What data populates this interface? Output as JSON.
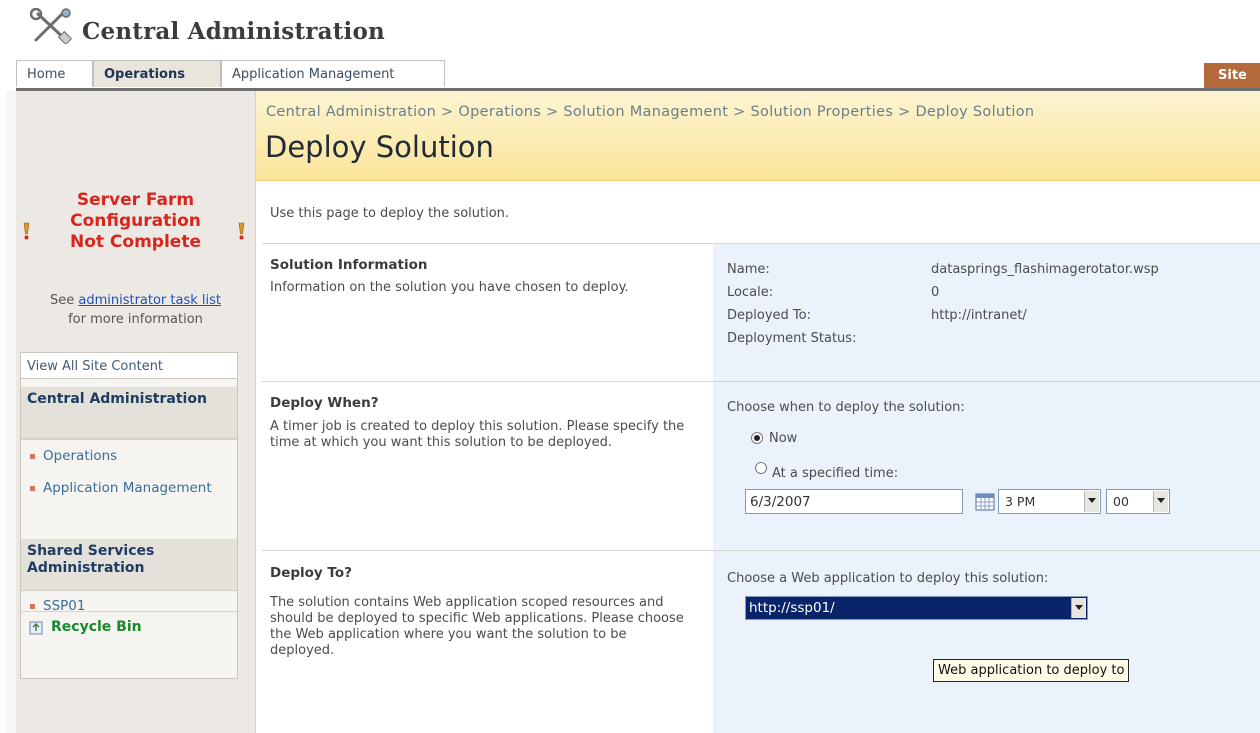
{
  "header": {
    "title": "Central Administration",
    "logo_icon": "tools-icon"
  },
  "tabs": [
    {
      "label": "Home"
    },
    {
      "label": "Operations",
      "active": true
    },
    {
      "label": "Application Management"
    }
  ],
  "site_actions_label": "Site A",
  "warning": {
    "line1": "Server Farm",
    "line2": "Configuration",
    "line3": "Not Complete",
    "see": "See",
    "link": "administrator task list",
    "more": "for more information"
  },
  "quicklaunch": {
    "view_all": "View All Site Content",
    "sections": [
      {
        "heading": "Central Administration",
        "items": [
          "Operations",
          "Application Management"
        ]
      },
      {
        "heading": "Shared Services Administration",
        "items": [
          "SSP01"
        ]
      }
    ],
    "recycle_bin": "Recycle Bin"
  },
  "breadcrumb": "Central Administration > Operations > Solution Management > Solution Properties > Deploy Solution",
  "page_title": "Deploy Solution",
  "intro": "Use this page to deploy the solution.",
  "solution_info": {
    "title": "Solution Information",
    "desc": "Information on the solution you have chosen to deploy.",
    "fields": [
      {
        "key": "Name:",
        "value": "datasprings_flashimagerotator.wsp"
      },
      {
        "key": "Locale:",
        "value": "0"
      },
      {
        "key": "Deployed To:",
        "value": "http://intranet/"
      },
      {
        "key": "Deployment Status:",
        "value": ""
      }
    ]
  },
  "deploy_when": {
    "title": "Deploy When?",
    "desc": "A timer job is created to deploy this solution. Please specify the time at which you want this solution to be deployed.",
    "prompt": "Choose when to deploy the solution:",
    "option_now": "Now",
    "option_specified": "At a specified time:",
    "selected": "Now",
    "date": "6/3/2007",
    "hour": "3 PM",
    "minute": "00"
  },
  "deploy_to": {
    "title": "Deploy To?",
    "desc": "The solution contains Web application scoped resources and should be deployed to specific Web applications. Please choose the Web application where you want the solution to be deployed.",
    "prompt": "Choose a Web application to deploy this solution:",
    "selected_app": "http://ssp01/",
    "tooltip": "Web application to deploy to"
  }
}
